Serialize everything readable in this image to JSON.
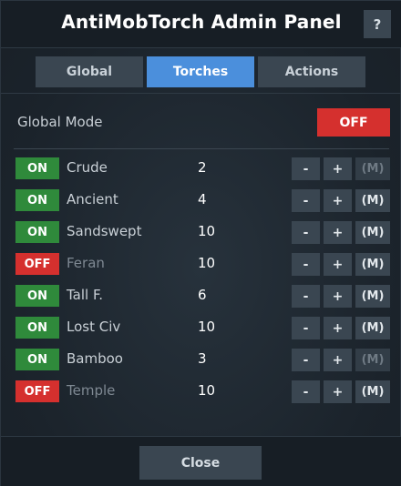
{
  "header": {
    "title": "AntiMobTorch Admin Panel",
    "help_label": "?"
  },
  "tabs": [
    {
      "label": "Global",
      "active": false
    },
    {
      "label": "Torches",
      "active": true
    },
    {
      "label": "Actions",
      "active": false
    }
  ],
  "global_mode": {
    "label": "Global Mode",
    "state": "OFF",
    "color": "#d5302e"
  },
  "torches": [
    {
      "state": "ON",
      "name": "Crude",
      "count": "2",
      "minus": "-",
      "plus": "+",
      "m": "(M)",
      "m_active": false
    },
    {
      "state": "ON",
      "name": "Ancient",
      "count": "4",
      "minus": "-",
      "plus": "+",
      "m": "(M)",
      "m_active": true
    },
    {
      "state": "ON",
      "name": "Sandswept",
      "count": "10",
      "minus": "-",
      "plus": "+",
      "m": "(M)",
      "m_active": true
    },
    {
      "state": "OFF",
      "name": "Feran",
      "count": "10",
      "minus": "-",
      "plus": "+",
      "m": "(M)",
      "m_active": true
    },
    {
      "state": "ON",
      "name": "Tall F.",
      "count": "6",
      "minus": "-",
      "plus": "+",
      "m": "(M)",
      "m_active": true
    },
    {
      "state": "ON",
      "name": "Lost Civ",
      "count": "10",
      "minus": "-",
      "plus": "+",
      "m": "(M)",
      "m_active": true
    },
    {
      "state": "ON",
      "name": "Bamboo",
      "count": "3",
      "minus": "-",
      "plus": "+",
      "m": "(M)",
      "m_active": false
    },
    {
      "state": "OFF",
      "name": "Temple",
      "count": "10",
      "minus": "-",
      "plus": "+",
      "m": "(M)",
      "m_active": true
    }
  ],
  "footer": {
    "close_label": "Close"
  },
  "colors": {
    "on": "#2f8a3b",
    "off": "#d5302e",
    "accent": "#4b8fdc"
  }
}
